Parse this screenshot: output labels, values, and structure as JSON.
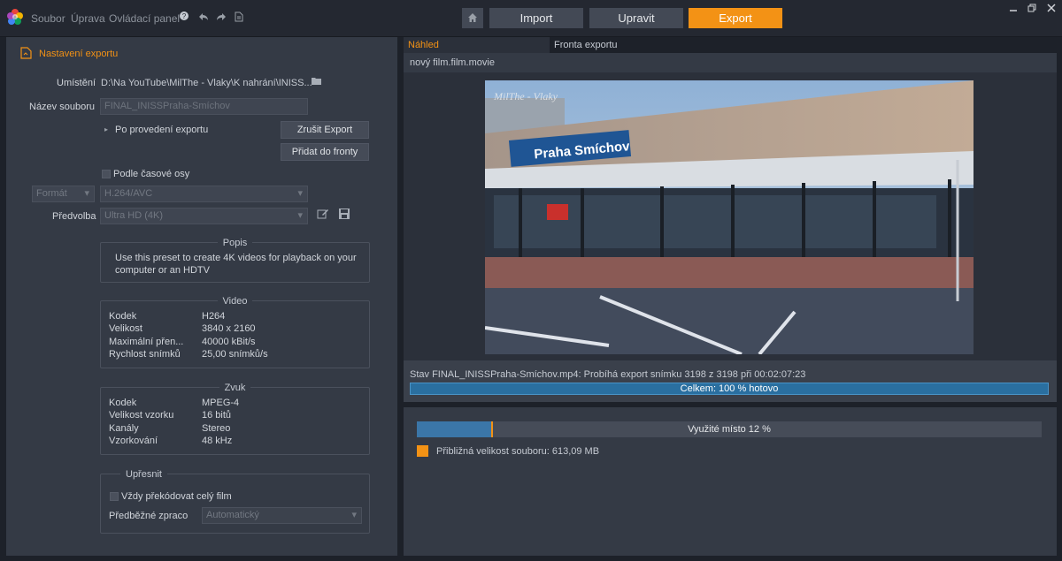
{
  "menu": {
    "file": "Soubor",
    "edit": "Úprava",
    "control": "Ovládací panel"
  },
  "nav": {
    "import": "Import",
    "edit": "Upravit",
    "export": "Export"
  },
  "left": {
    "section_title": "Nastavení exportu",
    "location_label": "Umístění",
    "location_value": "D:\\Na YouTube\\MilThe - Vlaky\\K nahrání\\INISS...",
    "filename_label": "Název souboru",
    "filename_value": "FINAL_INISSPraha-Smíchov",
    "after_export": "Po provedení exportu",
    "cancel_export": "Zrušit Export",
    "add_queue": "Přidat do fronty",
    "timeline_check": "Podle časové osy",
    "format_select": "Formát",
    "format_value": "H.264/AVC",
    "preset_label": "Předvolba",
    "preset_value": "Ultra HD (4K)",
    "desc_title": "Popis",
    "desc_text": "Use this preset to create 4K videos for playback on your computer or an HDTV",
    "video_title": "Video",
    "video_rows": [
      {
        "k": "Kodek",
        "v": "H264"
      },
      {
        "k": "Velikost",
        "v": "3840 x 2160"
      },
      {
        "k": "Maximální přen...",
        "v": "40000 kBit/s"
      },
      {
        "k": "Rychlost snímků",
        "v": "25,00 snímků/s"
      }
    ],
    "audio_title": "Zvuk",
    "audio_rows": [
      {
        "k": "Kodek",
        "v": "MPEG-4"
      },
      {
        "k": "Velikost vzorku",
        "v": "16 bitů"
      },
      {
        "k": "Kanály",
        "v": "Stereo"
      },
      {
        "k": "Vzorkování",
        "v": "48 kHz"
      }
    ],
    "refine_title": "Upřesnit",
    "always_transcode": "Vždy překódovat celý film",
    "prerender_label": "Předběžné zpraco",
    "prerender_value": "Automatický"
  },
  "right": {
    "tab_preview": "Náhled",
    "tab_queue": "Fronta exportu",
    "movie_name": "nový film.film.movie",
    "watermark": "MilThe - Vlaky",
    "station_sign": "Praha Smíchov",
    "status_text": "Stav FINAL_INISSPraha-Smíchov.mp4: Probíhá export snímku 3198 z 3198 při 00:02:07:23",
    "progress_text": "Celkem: 100 % hotovo",
    "progress_percent": 100,
    "space_text": "Využité místo 12 %",
    "space_percent": 12,
    "size_text": "Přibližná velikost souboru: 613,09 MB"
  },
  "colors": {
    "accent": "#f39215",
    "progress": "#2a6fa0"
  }
}
